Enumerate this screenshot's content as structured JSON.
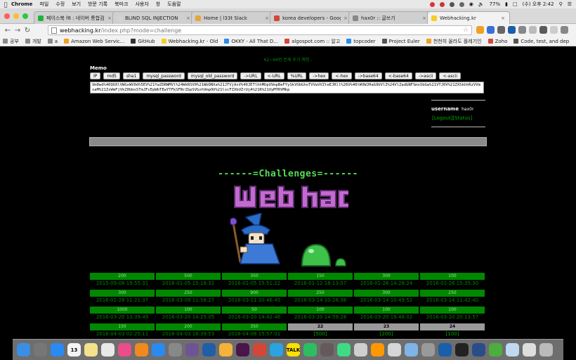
{
  "menubar": {
    "app": "Chrome",
    "items": [
      "파일",
      "수정",
      "보기",
      "방문 기록",
      "북마크",
      "사용자",
      "창",
      "도움말"
    ],
    "battery": "77%",
    "clock": "(수) 오후 2:42"
  },
  "tabs": [
    {
      "label": "페이스북 f8 : 네이버 통합검색",
      "color": "#1db33a"
    },
    {
      "label": "BLIND SQL INJECTION",
      "color": "#d3d3d3"
    },
    {
      "label": "Home | l33t Slack",
      "color": "#e8a33c"
    },
    {
      "label": "korea developers - Google",
      "color": "#d44638"
    },
    {
      "label": "hax0r :: 글쓰기",
      "color": "#888888"
    },
    {
      "label": "Webhacking.kr",
      "color": "#f3d021",
      "active": true
    }
  ],
  "address": {
    "host": "webhacking.kr",
    "path": "/index.php?mode=challenge"
  },
  "bookmarks": [
    {
      "label": "공부",
      "color": "#8a8a8a"
    },
    {
      "label": "개발",
      "color": "#8a8a8a"
    },
    {
      "label": "a",
      "color": "#8a8a8a"
    },
    {
      "label": "Amazon Web Servic...",
      "color": "#f0a020"
    },
    {
      "label": "GitHub",
      "color": "#333333"
    },
    {
      "label": "Webhacking.kr - Old",
      "color": "#f3d021"
    },
    {
      "label": "OKKY - All That D...",
      "color": "#2a8af0"
    },
    {
      "label": "algospot.com :: 알고",
      "color": "#d44638"
    },
    {
      "label": "topcoder",
      "color": "#2a8af0"
    },
    {
      "label": "Project Euler",
      "color": "#555555"
    },
    {
      "label": "천천히 올라도 플레기인",
      "color": "#f0a020"
    },
    {
      "label": "Zoho",
      "color": "#d44638"
    },
    {
      "label": "Code, test, and dep",
      "color": "#555555"
    }
  ],
  "page": {
    "notice": "62~66번 문제 추가 예정..",
    "memo_title": "Memo",
    "conv_buttons": [
      "IP",
      "md5",
      "sha1",
      "mysql_password",
      "mysql_old_password",
      "->URL",
      "<-URL",
      "%URL",
      "->hex",
      "<-hex",
      "->base64",
      "<-base64",
      "->ascii",
      "<-ascii"
    ],
    "memo_text": "Vm0wd%40QUXlVWGxWV0d%5EV%21YwZDRWMVl%24WkRSV0%21WbDNXa%21JTVjAxV%40JETlhhMUpUVmpBeFYySkVUbGhoTVVwVVZteEJRll%26U%40tWVWJHaG9UVlZ%24VlZadGNFSmxSbGw%21VTJ0V%21ZXSkhhRzVVmxaM%21ZsWmFjVkZ0UmxSTmJFcEpWbTEwYTFkSFNrZGpSVGxhVmpOU%21lxcFZXbUZrUjA%21R%21UyMTRVMkp",
    "username_label": "username",
    "username": "hax0r",
    "logout": "[Logout]",
    "status": "[Status]",
    "challenges_title": "------=Challenges=------",
    "logo_text": "Web hack"
  },
  "challenges": [
    {
      "points": "200",
      "date": "2015-09-08 19:55:31",
      "state": "solved"
    },
    {
      "points": "500",
      "date": "2016-01-05 15:16:32",
      "state": "solved"
    },
    {
      "points": "350",
      "date": "2016-01-05 15:51:22",
      "state": "solved"
    },
    {
      "points": "150",
      "date": "2016-01-12 18:13:07",
      "state": "solved"
    },
    {
      "points": "300",
      "date": "2016-01-26 14:28:24",
      "state": "solved"
    },
    {
      "points": "100",
      "date": "2016-01-26 15:35:30",
      "state": "solved"
    },
    {
      "points": "300",
      "date": "2016-01-28 11:21:37",
      "state": "solved"
    },
    {
      "points": "250",
      "date": "2016-03-09 11:56:27",
      "state": "solved"
    },
    {
      "points": "900",
      "date": "2016-03-11 20:46:45",
      "state": "solved"
    },
    {
      "points": "250",
      "date": "2016-03-14 10:26:38",
      "state": "solved"
    },
    {
      "points": "300",
      "date": "2016-03-14 10:49:52",
      "state": "solved"
    },
    {
      "points": "250",
      "date": "2016-03-14 11:42:40",
      "state": "solved"
    },
    {
      "points": "1000",
      "date": "2016-03-20 13:39:49",
      "state": "solved"
    },
    {
      "points": "100",
      "date": "2016-03-20 14:25:05",
      "state": "solved"
    },
    {
      "points": "50",
      "date": "2016-03-20 14:42:46",
      "state": "solved"
    },
    {
      "points": "100",
      "date": "2016-03-20 14:59:28",
      "state": "solved"
    },
    {
      "points": "100",
      "date": "2016-03-20 19:48:02",
      "state": "solved"
    },
    {
      "points": "100",
      "date": "2016-03-20 20:13:57",
      "state": "solved"
    },
    {
      "points": "150",
      "date": "2016-04-03 02:25:11",
      "state": "solved"
    },
    {
      "points": "200",
      "date": "2016-04-03 16:39:53",
      "state": "solved"
    },
    {
      "points": "350",
      "date": "2016-04-08 15:57:01",
      "state": "solved"
    },
    {
      "points": "22",
      "date": "[500]",
      "state": "locked"
    },
    {
      "points": "23",
      "date": "[200]",
      "state": "locked"
    },
    {
      "points": "24",
      "date": "[100]",
      "state": "locked"
    }
  ],
  "dock": [
    {
      "icon": "finder-icon",
      "color": "#3a8ee6"
    },
    {
      "icon": "launchpad-icon",
      "color": "#777777"
    },
    {
      "icon": "safari-icon",
      "color": "#2a8af0"
    },
    {
      "icon": "calendar-icon",
      "color": "#f4f4f4",
      "text": "13"
    },
    {
      "icon": "notes-icon",
      "color": "#f3e28a"
    },
    {
      "icon": "photos-icon",
      "color": "#e8e8e8"
    },
    {
      "icon": "itunes-icon",
      "color": "#e94d8a"
    },
    {
      "icon": "ibooks-icon",
      "color": "#f08a20"
    },
    {
      "icon": "app-store-icon",
      "color": "#2a8af0"
    },
    {
      "icon": "system-preferences-icon",
      "color": "#888888"
    },
    {
      "icon": "github-icon",
      "color": "#6e5494"
    },
    {
      "icon": "sourcetree-icon",
      "color": "#1f5fa8"
    },
    {
      "icon": "sketch-icon",
      "color": "#f4b23a"
    },
    {
      "icon": "slack-icon",
      "color": "#4a154b"
    },
    {
      "icon": "chrome-icon",
      "color": "#d44638"
    },
    {
      "icon": "telegram-icon",
      "color": "#2aa3e0"
    },
    {
      "icon": "kakaotalk-icon",
      "color": "#f9e000",
      "text": "TALK"
    },
    {
      "icon": "evernote-icon",
      "color": "#2dbe60"
    },
    {
      "icon": "atom-icon",
      "color": "#66595c"
    },
    {
      "icon": "android-studio-icon",
      "color": "#3ddc84"
    },
    {
      "icon": "preview-icon",
      "color": "#cfcfcf"
    },
    {
      "icon": "sublime-icon",
      "color": "#ff9800"
    },
    {
      "icon": "help-icon",
      "color": "#d6d6d6"
    },
    {
      "icon": "xcode-icon",
      "color": "#7fb4e6"
    },
    {
      "icon": "instruments-icon",
      "color": "#9a9a9a"
    },
    {
      "icon": "wireshark-icon",
      "color": "#1b5eab"
    },
    {
      "icon": "terminal-icon",
      "color": "#222222"
    },
    {
      "icon": "quicktime-icon",
      "color": "#2a4d8a"
    },
    {
      "icon": "utorrent-icon",
      "color": "#4cae3f"
    },
    {
      "icon": "mail-icon",
      "color": "#c0d8f0"
    },
    {
      "icon": "documents-icon",
      "color": "#dddddd"
    },
    {
      "icon": "trash-icon",
      "color": "#bbbbbb"
    }
  ],
  "colors": {
    "accent_green": "#008800",
    "title_green": "#55dd55",
    "logo_purple": "#c36ad0"
  }
}
